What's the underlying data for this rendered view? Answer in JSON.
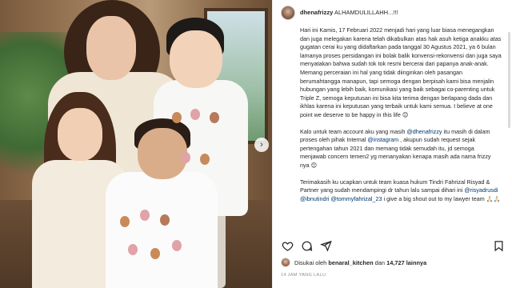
{
  "post": {
    "username": "dhenafrizzy",
    "headline": "ALHAMDULILLAHH...!!!",
    "paragraphs": [
      "Hari ini Kamis, 17 Februari 2022 menjadi hari yang luar biasa menegangkan dan juga melegakan karena telah dikabulkan atas hak asuh ketiga anakku atas gugatan cerai ku yang didaftarkan pada tanggal 30 Agustus 2021, ya 6 bulan lamanya proses persidangan ini bolak balik konvensi-rekonvensi dan juga saya menyatakan bahwa sudah tok tok resmi bercerai dari papanya anak-anak. Memang perceraian ini hal yang tidak diinginkan oleh pasangan berumahtangga manapun, tapi semoga dengan berpisah kami bisa menjalin hubungan yang lebih baik, komunikasi yang baik sebagai co-parenting untuk Triple Z, semoga keputusan ini bisa kita terima dengan berlapang dada dan ikhlas karena ini keputusan yang terbaik untuk kami semua. I believe at one point we deserve to be happy in this life 😊"
    ],
    "paragraph2_parts": [
      "Kalo untuk team account aku yang masih ",
      "@dhenafrizzy",
      " itu masih di dalam proses oleh pihak Internal ",
      "@instagram",
      " , akupun sudah request sejak pertengahan tahun 2021 dan memang tidak semudah itu, jd semoga menjawab concern temen2 yg menanyakan kenapa masih ada nama frizzy nya 😊"
    ],
    "paragraph3_parts": [
      "Terimakasih ku ucapkan untuk team kuasa hukum Tindri Fahrizal Risyad & Partner yang sudah mendampingi dr tahun lalu sampai dihari ini ",
      "@risyadrusdi",
      " ",
      "@ibnutindri",
      " ",
      "@tommyfahrizal_23",
      " i give a big shout out to my lawyer team 🙏🏻🙏🏻"
    ]
  },
  "actions": {
    "like_icon": "heart-icon",
    "comment_icon": "comment-icon",
    "share_icon": "share-icon",
    "save_icon": "bookmark-icon"
  },
  "likes": {
    "prefix": "Disukai oleh",
    "liker": "benaral_kitchen",
    "connector": "dan",
    "count": "14,727 lainnya"
  },
  "timestamp": "14 JAM YANG LALU",
  "carousel": {
    "next_icon": "chevron-right-icon"
  },
  "colors": {
    "mention": "#00376b",
    "muted": "#8e8e8e",
    "text": "#262626"
  }
}
